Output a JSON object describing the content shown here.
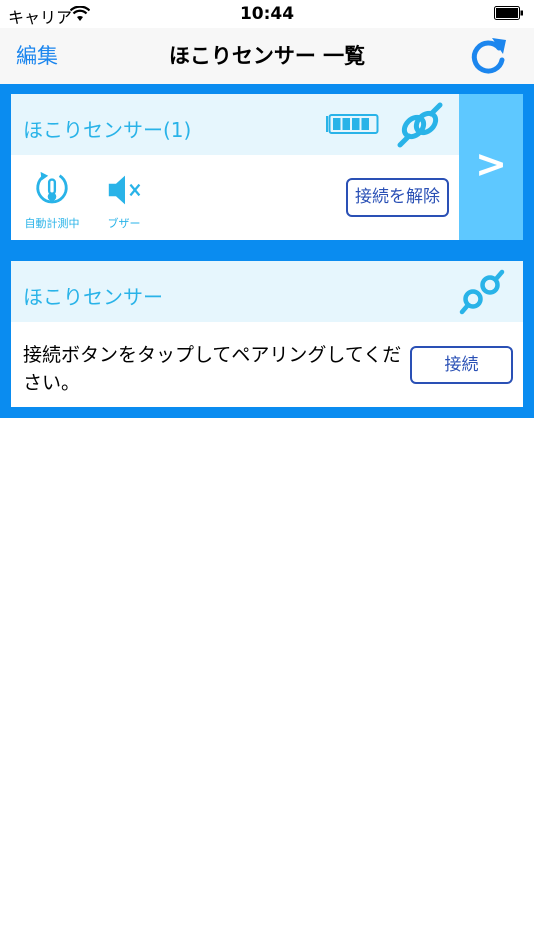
{
  "status": {
    "carrier": "キャリア",
    "time": "10:44"
  },
  "nav": {
    "edit": "編集",
    "title": "ほこりセンサー 一覧"
  },
  "devices": [
    {
      "name": "ほこりセンサー(1)",
      "auto_label": "自動計測中",
      "buzzer_label": "ブザー",
      "disconnect_label": "接続を解除",
      "arrow": ">"
    },
    {
      "name": "ほこりセンサー",
      "message": "接続ボタンをタップしてペアリングしてください。",
      "connect_label": "接続"
    }
  ],
  "colors": {
    "accent": "#1c86ee",
    "list_bg": "#0a8cf0",
    "header_bg": "#e6f6fd",
    "icon": "#29b3e8",
    "button_border": "#2a50b5"
  }
}
